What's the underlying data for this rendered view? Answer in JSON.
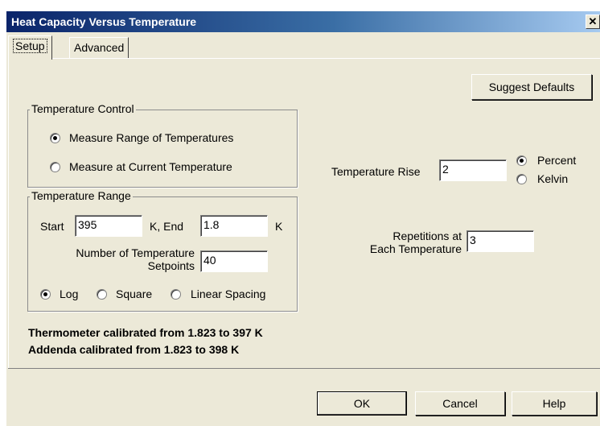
{
  "window": {
    "title": "Heat Capacity Versus Temperature",
    "close_glyph": "✕"
  },
  "tabs": [
    {
      "label": "Setup",
      "active": true
    },
    {
      "label": "Advanced",
      "active": false
    }
  ],
  "suggest_defaults_label": "Suggest Defaults",
  "temperature_control": {
    "title": "Temperature Control",
    "options": [
      {
        "label": "Measure Range of Temperatures",
        "checked": true
      },
      {
        "label": "Measure at Current Temperature",
        "checked": false
      }
    ]
  },
  "temperature_range": {
    "title": "Temperature Range",
    "start_label": "Start",
    "start_value": "395",
    "end_label": "K,  End",
    "end_value": "1.8",
    "end_unit": "K",
    "setpoints_label_line1": "Number of Temperature",
    "setpoints_label_line2": "Setpoints",
    "setpoints_value": "40",
    "spacing": [
      {
        "label": "Log",
        "checked": true
      },
      {
        "label": "Square",
        "checked": false
      },
      {
        "label": "Linear Spacing",
        "checked": false
      }
    ]
  },
  "temperature_rise": {
    "label": "Temperature Rise",
    "value": "2",
    "units": [
      {
        "label": "Percent",
        "checked": true
      },
      {
        "label": "Kelvin",
        "checked": false
      }
    ]
  },
  "repetitions": {
    "label_line1": "Repetitions at",
    "label_line2": "Each Temperature",
    "value": "3"
  },
  "calibration": {
    "thermometer": "Thermometer calibrated from 1.823 to 397 K",
    "addenda": "Addenda calibrated from 1.823 to 398 K"
  },
  "buttons": {
    "ok": "OK",
    "cancel": "Cancel",
    "help": "Help"
  }
}
